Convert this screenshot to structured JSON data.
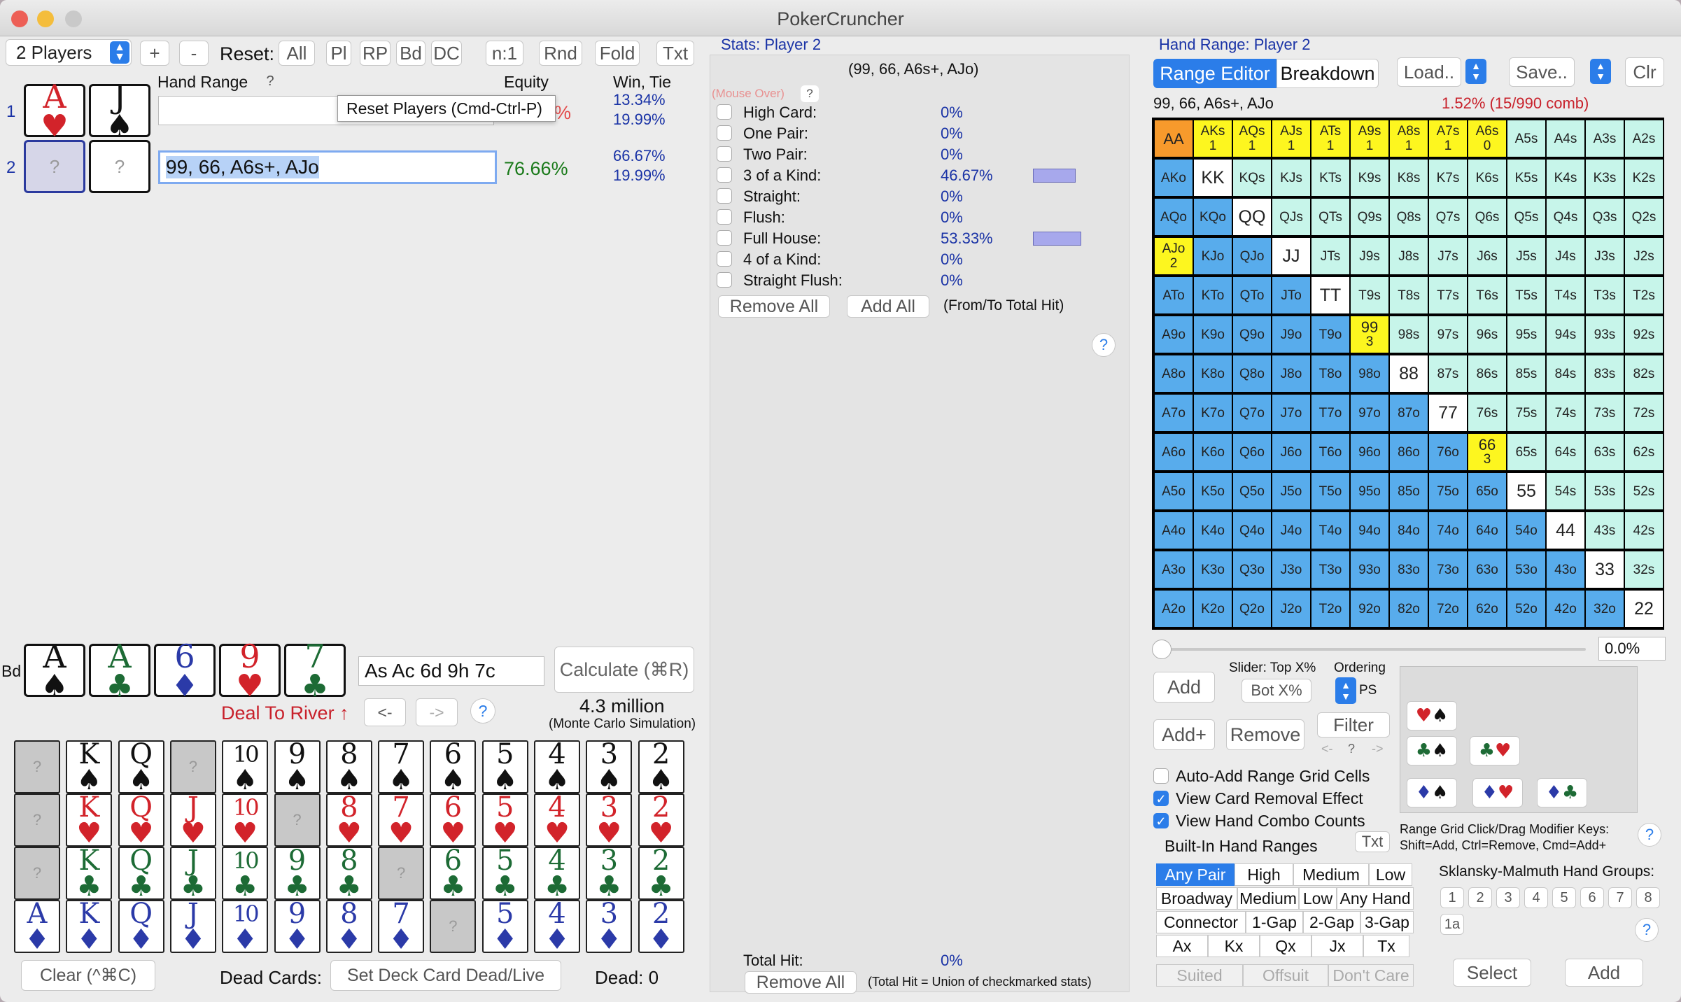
{
  "app": {
    "title": "PokerCruncher"
  },
  "toolbar": {
    "players_select": "2 Players",
    "plus": "+",
    "minus": "-",
    "reset_label": "Reset:",
    "reset_buttons": [
      "All",
      "Pl",
      "RP",
      "Bd",
      "DC",
      "n:1",
      "Rnd",
      "Fold",
      "Txt"
    ]
  },
  "players_panel": {
    "hand_range_header": "Hand Range",
    "help": "?",
    "equity_header": "Equity",
    "win_tie_header": "Win, Tie",
    "tooltip": "Reset Players (Cmd-Ctrl-P)",
    "players": [
      {
        "num": "1",
        "card1_rank": "A",
        "card1_suit": "♥",
        "card2_rank": "J",
        "card2_suit": "♠",
        "range": "",
        "equity_frag": "%",
        "win": "13.34%",
        "tie": "19.99%"
      },
      {
        "num": "2",
        "card1": "?",
        "card2": "?",
        "range": "99, 66, A6s+, AJo",
        "equity": "76.66%",
        "win": "66.67%",
        "tie": "19.99%"
      }
    ]
  },
  "board": {
    "label": "Bd",
    "cards": [
      {
        "rank": "A",
        "suit": "♠"
      },
      {
        "rank": "A",
        "suit": "♣"
      },
      {
        "rank": "6",
        "suit": "♦"
      },
      {
        "rank": "9",
        "suit": "♥"
      },
      {
        "rank": "7",
        "suit": "♣"
      }
    ],
    "text": "As Ac 6d 9h 7c",
    "calculate": "Calculate (⌘R)",
    "deal_to_river": "Deal To River ↑",
    "back": "<-",
    "forward": "->",
    "help": "?",
    "sims": "4.3 million",
    "sims_note": "(Monte Carlo Simulation)"
  },
  "deck": {
    "ranks": [
      "A",
      "K",
      "Q",
      "J",
      "10",
      "9",
      "8",
      "7",
      "6",
      "5",
      "4",
      "3",
      "2"
    ],
    "rows": [
      {
        "suit": "♠",
        "dead_index": [
          0,
          3
        ]
      },
      {
        "suit": "♥",
        "dead_index": [
          0,
          5
        ]
      },
      {
        "suit": "♣",
        "dead_index": [
          0,
          7
        ]
      },
      {
        "suit": "♦",
        "dead_index": [
          8
        ]
      }
    ],
    "dead_mark": "?",
    "clear": "Clear (^⌘C)",
    "dead_cards_label": "Dead Cards:",
    "set_dead": "Set Deck Card Dead/Live",
    "dead_count": "Dead: 0"
  },
  "stats": {
    "header": "Stats: Player 2",
    "range": "(99, 66, A6s+, AJo)",
    "mouse_over": "(Mouse Over)",
    "help": "?",
    "rows": [
      {
        "name": "High Card:",
        "pct": "0%"
      },
      {
        "name": "One Pair:",
        "pct": "0%"
      },
      {
        "name": "Two Pair:",
        "pct": "0%"
      },
      {
        "name": "3 of a Kind:",
        "pct": "46.67%",
        "bar": 0.4667
      },
      {
        "name": "Straight:",
        "pct": "0%"
      },
      {
        "name": "Flush:",
        "pct": "0%"
      },
      {
        "name": "Full House:",
        "pct": "53.33%",
        "bar": 0.5333
      },
      {
        "name": "4 of a Kind:",
        "pct": "0%"
      },
      {
        "name": "Straight Flush:",
        "pct": "0%"
      }
    ],
    "remove_all": "Remove All",
    "add_all": "Add All",
    "from_to": "(From/To Total Hit)",
    "help2": "?",
    "total_hit_label": "Total Hit:",
    "total_hit": "0%",
    "remove_all2": "Remove All",
    "total_note": "(Total Hit = Union of checkmarked stats)"
  },
  "range_panel": {
    "header": "Hand Range: Player 2",
    "tab_editor": "Range Editor",
    "tab_breakdown": "Breakdown",
    "load": "Load..",
    "save": "Save..",
    "clr": "Clr",
    "range_text": "99, 66, A6s+, AJo",
    "pct": "1.52%  (15/990 comb)",
    "grid_ranks": [
      "A",
      "K",
      "Q",
      "J",
      "T",
      "9",
      "8",
      "7",
      "6",
      "5",
      "4",
      "3",
      "2"
    ],
    "selected": [
      {
        "hand": "AA",
        "count": "",
        "color": "#f79a2c"
      },
      {
        "hand": "AKs",
        "count": "1"
      },
      {
        "hand": "AQs",
        "count": "1"
      },
      {
        "hand": "AJs",
        "count": "1"
      },
      {
        "hand": "ATs",
        "count": "1"
      },
      {
        "hand": "A9s",
        "count": "1"
      },
      {
        "hand": "A8s",
        "count": "1"
      },
      {
        "hand": "A7s",
        "count": "1"
      },
      {
        "hand": "A6s",
        "count": "0"
      },
      {
        "hand": "AJo",
        "count": "2"
      },
      {
        "hand": "99",
        "count": "3"
      },
      {
        "hand": "66",
        "count": "3"
      }
    ],
    "slider_value": "0.0%",
    "add": "Add",
    "slider_label": "Slider: Top X%",
    "bot": "Bot X%",
    "ordering": "Ordering",
    "ps": "PS",
    "add_plus": "Add+",
    "remove": "Remove",
    "filter": "Filter",
    "filter_nav": [
      "<-",
      "?",
      "->"
    ],
    "checkboxes": [
      {
        "label": "Auto-Add Range Grid Cells",
        "checked": false
      },
      {
        "label": "View Card Removal Effect",
        "checked": true
      },
      {
        "label": "View Hand Combo Counts",
        "checked": true
      }
    ],
    "builtin": "Built-In Hand Ranges",
    "txt": "Txt",
    "suit_combos": [
      [
        "♥",
        "♠"
      ],
      [
        "♣",
        "♠"
      ],
      [
        "♣",
        "♥"
      ],
      [
        "♦",
        "♠"
      ],
      [
        "♦",
        "♥"
      ],
      [
        "♦",
        "♣"
      ]
    ],
    "modifier_note1": "Range Grid Click/Drag Modifier Keys:",
    "modifier_note2": "Shift=Add, Ctrl=Remove, Cmd=Add+",
    "help": "?",
    "seg_row1": [
      "Any Pair",
      "High",
      "Medium",
      "Low"
    ],
    "seg_row2": [
      "Broadway",
      "Medium",
      "Low",
      "Any Hand"
    ],
    "seg_row3": [
      "Connector",
      "1-Gap",
      "2-Gap",
      "3-Gap"
    ],
    "seg_row4": [
      "Ax",
      "Kx",
      "Qx",
      "Jx",
      "Tx"
    ],
    "seg_row5": [
      "Suited",
      "Offsuit",
      "Don't Care"
    ],
    "sklansky_title": "Sklansky-Malmuth Hand Groups:",
    "sklansky": [
      "1",
      "2",
      "3",
      "4",
      "5",
      "6",
      "7",
      "8"
    ],
    "sklansky_1a": "1a",
    "help2": "?",
    "select": "Select",
    "add_bottom": "Add"
  },
  "colors": {
    "accent": "#2b7de9",
    "pair": "#ffffff",
    "suited": "#c7f5ea",
    "offsuit": "#58acec",
    "selected": "#fdf61f",
    "aa": "#f79a2c"
  }
}
